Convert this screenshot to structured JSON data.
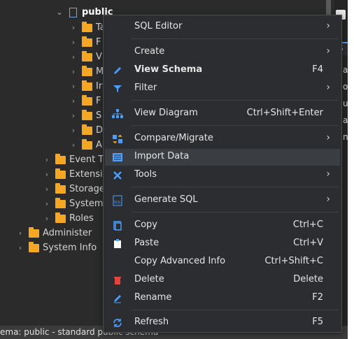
{
  "tree": {
    "public_label": "public",
    "children_labels": [
      "Ta",
      "F",
      "V",
      "M",
      "Ir",
      "F",
      "S",
      "D",
      "A"
    ],
    "nodes": [
      {
        "label": "Event Tr"
      },
      {
        "label": "Extensic"
      },
      {
        "label": "Storage"
      },
      {
        "label": "System"
      },
      {
        "label": "Roles"
      },
      {
        "label": "Administer"
      },
      {
        "label": "System Info"
      }
    ]
  },
  "right_pane": {
    "fragments": [
      "S",
      "am",
      "od",
      "ue",
      "art",
      "nis"
    ]
  },
  "status_bar": {
    "text": "ema: public - standard public schema"
  },
  "context_menu": {
    "items": [
      {
        "label": "SQL Editor",
        "icon": "none",
        "submenu": true,
        "shortcut": ""
      },
      {
        "label": "Create",
        "icon": "none",
        "submenu": true,
        "shortcut": ""
      },
      {
        "label": "View Schema",
        "icon": "pencil-icon",
        "submenu": false,
        "shortcut": "F4",
        "bold": true
      },
      {
        "label": "Filter",
        "icon": "filter-icon",
        "submenu": true,
        "shortcut": ""
      },
      {
        "label": "View Diagram",
        "icon": "diagram-icon",
        "submenu": false,
        "shortcut": "Ctrl+Shift+Enter"
      },
      {
        "label": "Compare/Migrate",
        "icon": "compare-icon",
        "submenu": true,
        "shortcut": ""
      },
      {
        "label": "Import Data",
        "icon": "import-icon",
        "submenu": false,
        "shortcut": "",
        "highlighted": true
      },
      {
        "label": "Tools",
        "icon": "tools-icon",
        "submenu": true,
        "shortcut": ""
      },
      {
        "label": "Generate SQL",
        "icon": "sql-icon",
        "submenu": true,
        "shortcut": ""
      },
      {
        "label": "Copy",
        "icon": "copy-icon",
        "submenu": false,
        "shortcut": "Ctrl+C"
      },
      {
        "label": "Paste",
        "icon": "paste-icon",
        "submenu": false,
        "shortcut": "Ctrl+V"
      },
      {
        "label": "Copy Advanced Info",
        "icon": "none",
        "submenu": false,
        "shortcut": "Ctrl+Shift+C"
      },
      {
        "label": "Delete",
        "icon": "delete-icon",
        "submenu": false,
        "shortcut": "Delete"
      },
      {
        "label": "Rename",
        "icon": "rename-icon",
        "submenu": false,
        "shortcut": "F2"
      },
      {
        "label": "Refresh",
        "icon": "refresh-icon",
        "submenu": false,
        "shortcut": "F5"
      }
    ]
  },
  "colors": {
    "folder": "#f5a623",
    "menu_bg": "#2b2d30",
    "tree_bg": "#2b2b2b",
    "accent_blue": "#4a9eff",
    "delete_red": "#e5433b"
  }
}
